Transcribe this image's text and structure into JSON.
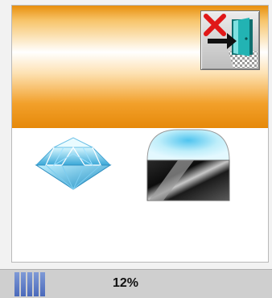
{
  "toolbar": {
    "exit_icon": "exit-door-icon"
  },
  "shapes": [
    {
      "name": "diamond-gem-image"
    },
    {
      "name": "rounded-capsule-shape-image"
    }
  ],
  "status": {
    "progress_percent": 12,
    "progress_text": "12%"
  },
  "colors": {
    "banner_orange": "#e88f0c",
    "progress_blue": "#4a69bb",
    "exit_x_red": "#e01818",
    "door_teal": "#1ea6a6"
  }
}
